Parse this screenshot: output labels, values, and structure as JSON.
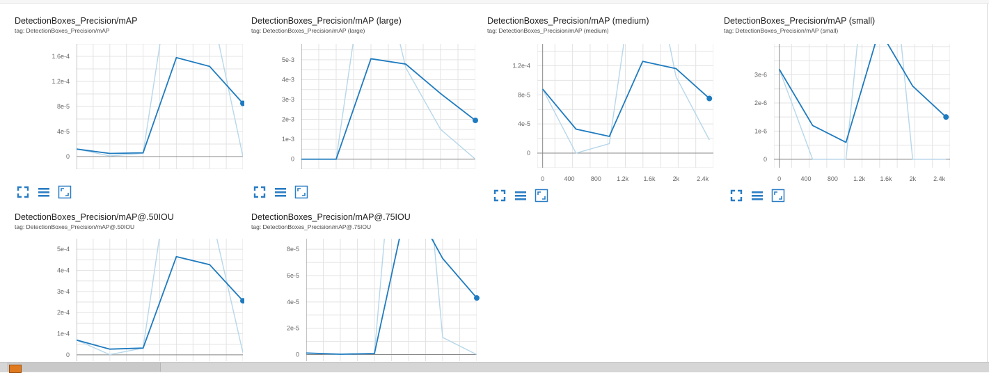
{
  "colors": {
    "line": "#1f7bbf",
    "raw_line": "#b7d7ea",
    "grid": "#e3e3e3",
    "axis": "#888888",
    "control": "#2a7dc4"
  },
  "cards": [
    {
      "title": "DetectionBoxes_Precision/mAP",
      "tag": "tag: DetectionBoxes_Precision/mAP",
      "controls": [
        "fit-domain-icon",
        "data-table-icon",
        "expand-icon"
      ]
    },
    {
      "title": "DetectionBoxes_Precision/mAP (large)",
      "tag": "tag: DetectionBoxes_Precision/mAP (large)",
      "controls": [
        "fit-domain-icon",
        "data-table-icon",
        "expand-icon"
      ]
    },
    {
      "title": "DetectionBoxes_Precision/mAP (medium)",
      "tag": "tag: DetectionBoxes_Precision/mAP (medium)",
      "controls": [
        "fit-domain-icon",
        "data-table-icon",
        "expand-icon"
      ]
    },
    {
      "title": "DetectionBoxes_Precision/mAP (small)",
      "tag": "tag: DetectionBoxes_Precision/mAP (small)",
      "controls": [
        "fit-domain-icon",
        "data-table-icon",
        "expand-icon"
      ]
    },
    {
      "title": "DetectionBoxes_Precision/mAP@.50IOU",
      "tag": "tag: DetectionBoxes_Precision/mAP@.50IOU",
      "controls": []
    },
    {
      "title": "DetectionBoxes_Precision/mAP@.75IOU",
      "tag": "tag: DetectionBoxes_Precision/mAP@.75IOU",
      "controls": []
    }
  ],
  "chart_data": [
    {
      "type": "line",
      "title": "DetectionBoxes_Precision/mAP",
      "ylim": [
        -2e-05,
        0.00018
      ],
      "xlim": [
        0,
        2500
      ],
      "y_ticks": [
        0,
        4e-05,
        8e-05,
        0.00012,
        0.00016
      ],
      "y_tick_labels": [
        "0",
        "4e-5",
        "8e-5",
        "1.2e-4",
        "1.6e-4"
      ],
      "x_ticks": [],
      "x_tick_labels": [],
      "grid": true,
      "series": [
        {
          "x": [
            0,
            500,
            1000,
            1500,
            2000,
            2500
          ],
          "y": [
            1.2e-05,
            5e-06,
            6e-06,
            0.000158,
            0.000144,
            8.5e-05
          ]
        }
      ],
      "raw_series": [
        {
          "x": [
            0,
            500,
            1000,
            1500,
            2000,
            2500
          ],
          "y": [
            1.2e-05,
            1e-06,
            5e-06,
            0.00035,
            0.00025,
            0.0
          ]
        }
      ]
    },
    {
      "type": "line",
      "title": "DetectionBoxes_Precision/mAP (large)",
      "ylim": [
        -0.0005,
        0.0058
      ],
      "xlim": [
        0,
        2500
      ],
      "y_ticks": [
        0,
        0.001,
        0.002,
        0.003,
        0.004,
        0.005
      ],
      "y_tick_labels": [
        "0",
        "1e-3",
        "2e-3",
        "3e-3",
        "4e-3",
        "5e-3"
      ],
      "x_ticks": [],
      "x_tick_labels": [],
      "grid": true,
      "series": [
        {
          "x": [
            0,
            500,
            1000,
            1500,
            2000,
            2500
          ],
          "y": [
            0.0,
            0.0,
            0.00505,
            0.00478,
            0.0033,
            0.00195
          ]
        }
      ],
      "raw_series": [
        {
          "x": [
            0,
            500,
            1000,
            1500,
            2000,
            2500
          ],
          "y": [
            0.0,
            0.0,
            0.012,
            0.0046,
            0.0015,
            0.0
          ]
        }
      ]
    },
    {
      "type": "line",
      "title": "DetectionBoxes_Precision/mAP (medium)",
      "ylim": [
        -2e-05,
        0.00015
      ],
      "xlim": [
        -80,
        2560
      ],
      "y_ticks": [
        0,
        4e-05,
        8e-05,
        0.00012
      ],
      "y_tick_labels": [
        "0",
        "4e-5",
        "8e-5",
        "1.2e-4"
      ],
      "x_ticks": [
        0,
        400,
        800,
        1200,
        1600,
        2000,
        2400
      ],
      "x_tick_labels": [
        "0",
        "400",
        "800",
        "1.2k",
        "1.6k",
        "2k",
        "2.4k"
      ],
      "grid": true,
      "series": [
        {
          "x": [
            0,
            500,
            1000,
            1500,
            2000,
            2500
          ],
          "y": [
            8.8e-05,
            3.3e-05,
            2.3e-05,
            0.000126,
            0.000116,
            7.5e-05
          ]
        }
      ],
      "raw_series": [
        {
          "x": [
            0,
            500,
            1000,
            1500,
            2000,
            2500
          ],
          "y": [
            8.8e-05,
            0.0,
            1.3e-05,
            0.00033,
            0.000105,
            1.8e-05
          ]
        }
      ]
    },
    {
      "type": "line",
      "title": "DetectionBoxes_Precision/mAP (small)",
      "ylim": [
        -3e-07,
        4.1e-06
      ],
      "xlim": [
        -80,
        2560
      ],
      "y_ticks": [
        0,
        1e-06,
        2e-06,
        3e-06
      ],
      "y_tick_labels": [
        "0",
        "1e-6",
        "2e-6",
        "3e-6"
      ],
      "x_ticks": [
        0,
        400,
        800,
        1200,
        1600,
        2000,
        2400
      ],
      "x_tick_labels": [
        "0",
        "400",
        "800",
        "1.2k",
        "1.6k",
        "2k",
        "2.4k"
      ],
      "grid": true,
      "series": [
        {
          "x": [
            0,
            500,
            1000,
            1500,
            2000,
            2500
          ],
          "y": [
            3.2e-06,
            1.2e-06,
            6e-07,
            4.6e-06,
            2.6e-06,
            1.5e-06
          ]
        }
      ],
      "raw_series": [
        {
          "x": [
            0,
            500,
            1000,
            1500,
            2000,
            2500
          ],
          "y": [
            3.2e-06,
            0.0,
            0.0,
            1.2e-05,
            0.0,
            0.0
          ]
        }
      ]
    },
    {
      "type": "line",
      "title": "DetectionBoxes_Precision/mAP@.50IOU",
      "ylim": [
        -3e-05,
        0.00055
      ],
      "xlim": [
        0,
        2500
      ],
      "y_ticks": [
        0,
        0.0001,
        0.0002,
        0.0003,
        0.0004,
        0.0005
      ],
      "y_tick_labels": [
        "0",
        "1e-4",
        "2e-4",
        "3e-4",
        "4e-4",
        "5e-4"
      ],
      "x_ticks": [],
      "x_tick_labels": [],
      "grid": true,
      "series": [
        {
          "x": [
            0,
            500,
            1000,
            1500,
            2000,
            2500
          ],
          "y": [
            7e-05,
            2.7e-05,
            3.2e-05,
            0.000465,
            0.000427,
            0.000256
          ]
        }
      ],
      "raw_series": [
        {
          "x": [
            0,
            500,
            1000,
            1500,
            2000,
            2500
          ],
          "y": [
            7e-05,
            1e-06,
            3.2e-05,
            0.0011,
            0.0007,
            1e-05
          ]
        }
      ]
    },
    {
      "type": "line",
      "title": "DetectionBoxes_Precision/mAP@.75IOU",
      "ylim": [
        -5e-06,
        8.8e-05
      ],
      "xlim": [
        0,
        2500
      ],
      "y_ticks": [
        0,
        2e-05,
        4e-05,
        6e-05,
        8e-05
      ],
      "y_tick_labels": [
        "0",
        "2e-5",
        "4e-5",
        "6e-5",
        "8e-5"
      ],
      "x_ticks": [],
      "x_tick_labels": [],
      "grid": true,
      "series": [
        {
          "x": [
            0,
            500,
            1000,
            1500,
            2000,
            2500
          ],
          "y": [
            1.2e-06,
            3e-07,
            8e-07,
            0.00012,
            7.3e-05,
            4.3e-05
          ]
        }
      ],
      "raw_series": [
        {
          "x": [
            0,
            500,
            1000,
            1500,
            2000,
            2500
          ],
          "y": [
            1.2e-06,
            0.0,
            8e-07,
            0.0003,
            1.3e-05,
            0.0
          ]
        }
      ]
    }
  ]
}
